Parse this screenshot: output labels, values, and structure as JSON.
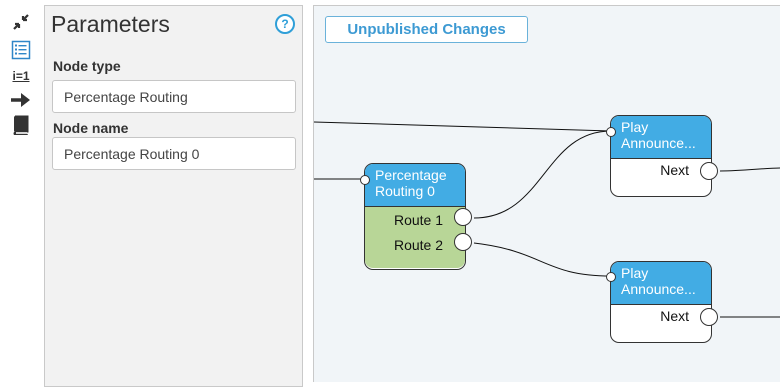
{
  "sidebar": {
    "icons": [
      {
        "name": "collapse-icon"
      },
      {
        "name": "list-icon"
      },
      {
        "name": "variable-icon",
        "label": "i=1"
      },
      {
        "name": "arrow-right-icon"
      },
      {
        "name": "book-icon"
      }
    ]
  },
  "panel": {
    "title": "Parameters",
    "help_label": "?",
    "node_type_label": "Node type",
    "node_type_value": "Percentage Routing",
    "node_name_label": "Node name",
    "node_name_value": "Percentage Routing 0"
  },
  "canvas": {
    "status_label": "Unpublished Changes",
    "nodes": {
      "routing": {
        "line1": "Percentage",
        "line2": "Routing 0",
        "route1": "Route 1",
        "route2": "Route 2"
      },
      "play1": {
        "line1": "Play",
        "line2": "Announce...",
        "next": "Next"
      },
      "play2": {
        "line1": "Play",
        "line2": "Announce...",
        "next": "Next"
      }
    }
  },
  "colors": {
    "accent": "#2f9fd8",
    "node_header": "#42ace4",
    "routing_body": "#b8d697",
    "canvas_bg": "#f1f5f8",
    "panel_bg": "#f2f2f2"
  }
}
